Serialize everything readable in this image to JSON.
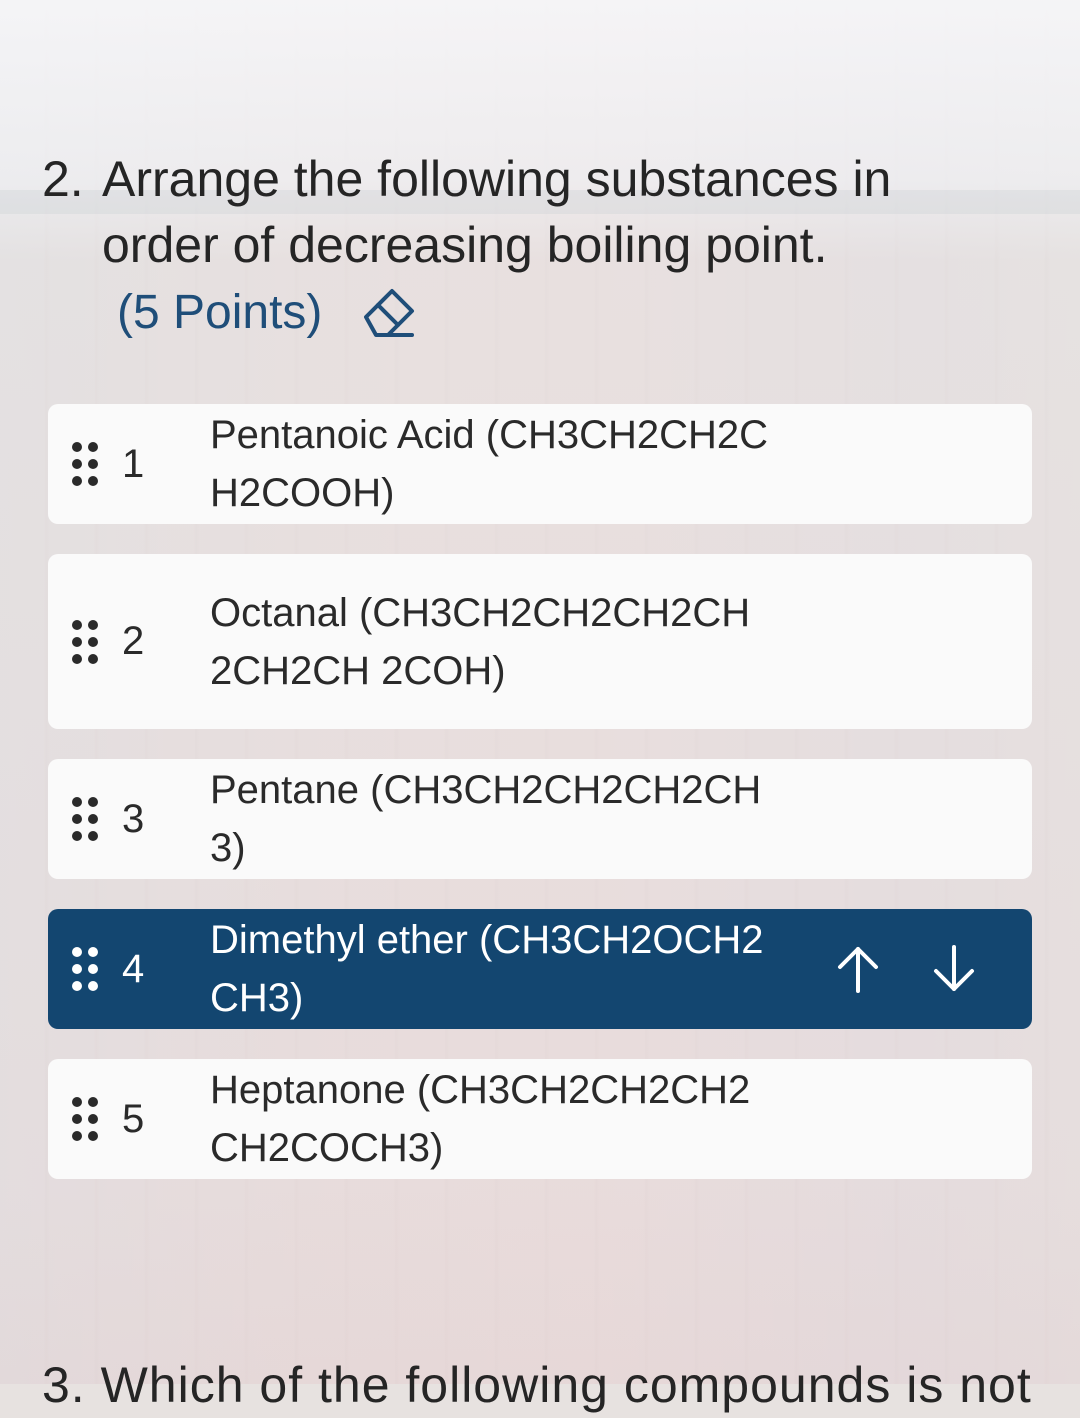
{
  "question": {
    "number": "2.",
    "text": "Arrange the following substances in order of decreasing boiling point.",
    "points": "(5 Points)",
    "points_icon": "eraser-icon"
  },
  "items": [
    {
      "rank": "1",
      "label": "Pentanoic Acid (CH3CH2CH2CH2COOH)",
      "selected": false
    },
    {
      "rank": "2",
      "label": "Octanal (CH3CH2CH2CH2CH2CH2CH 2COH)",
      "selected": false
    },
    {
      "rank": "3",
      "label": "Pentane (CH3CH2CH2CH2CH3)",
      "selected": false
    },
    {
      "rank": "4",
      "label": "Dimethyl ether (CH3CH2OCH2CH3)",
      "selected": true
    },
    {
      "rank": "5",
      "label": "Heptanone (CH3CH2CH2CH2CH2COCH3)",
      "selected": false
    }
  ],
  "next_question": {
    "text": "3. Which of the following compounds is not"
  },
  "colors": {
    "accent": "#134670",
    "points_text": "#1f4e79",
    "card": "#fafafa"
  }
}
